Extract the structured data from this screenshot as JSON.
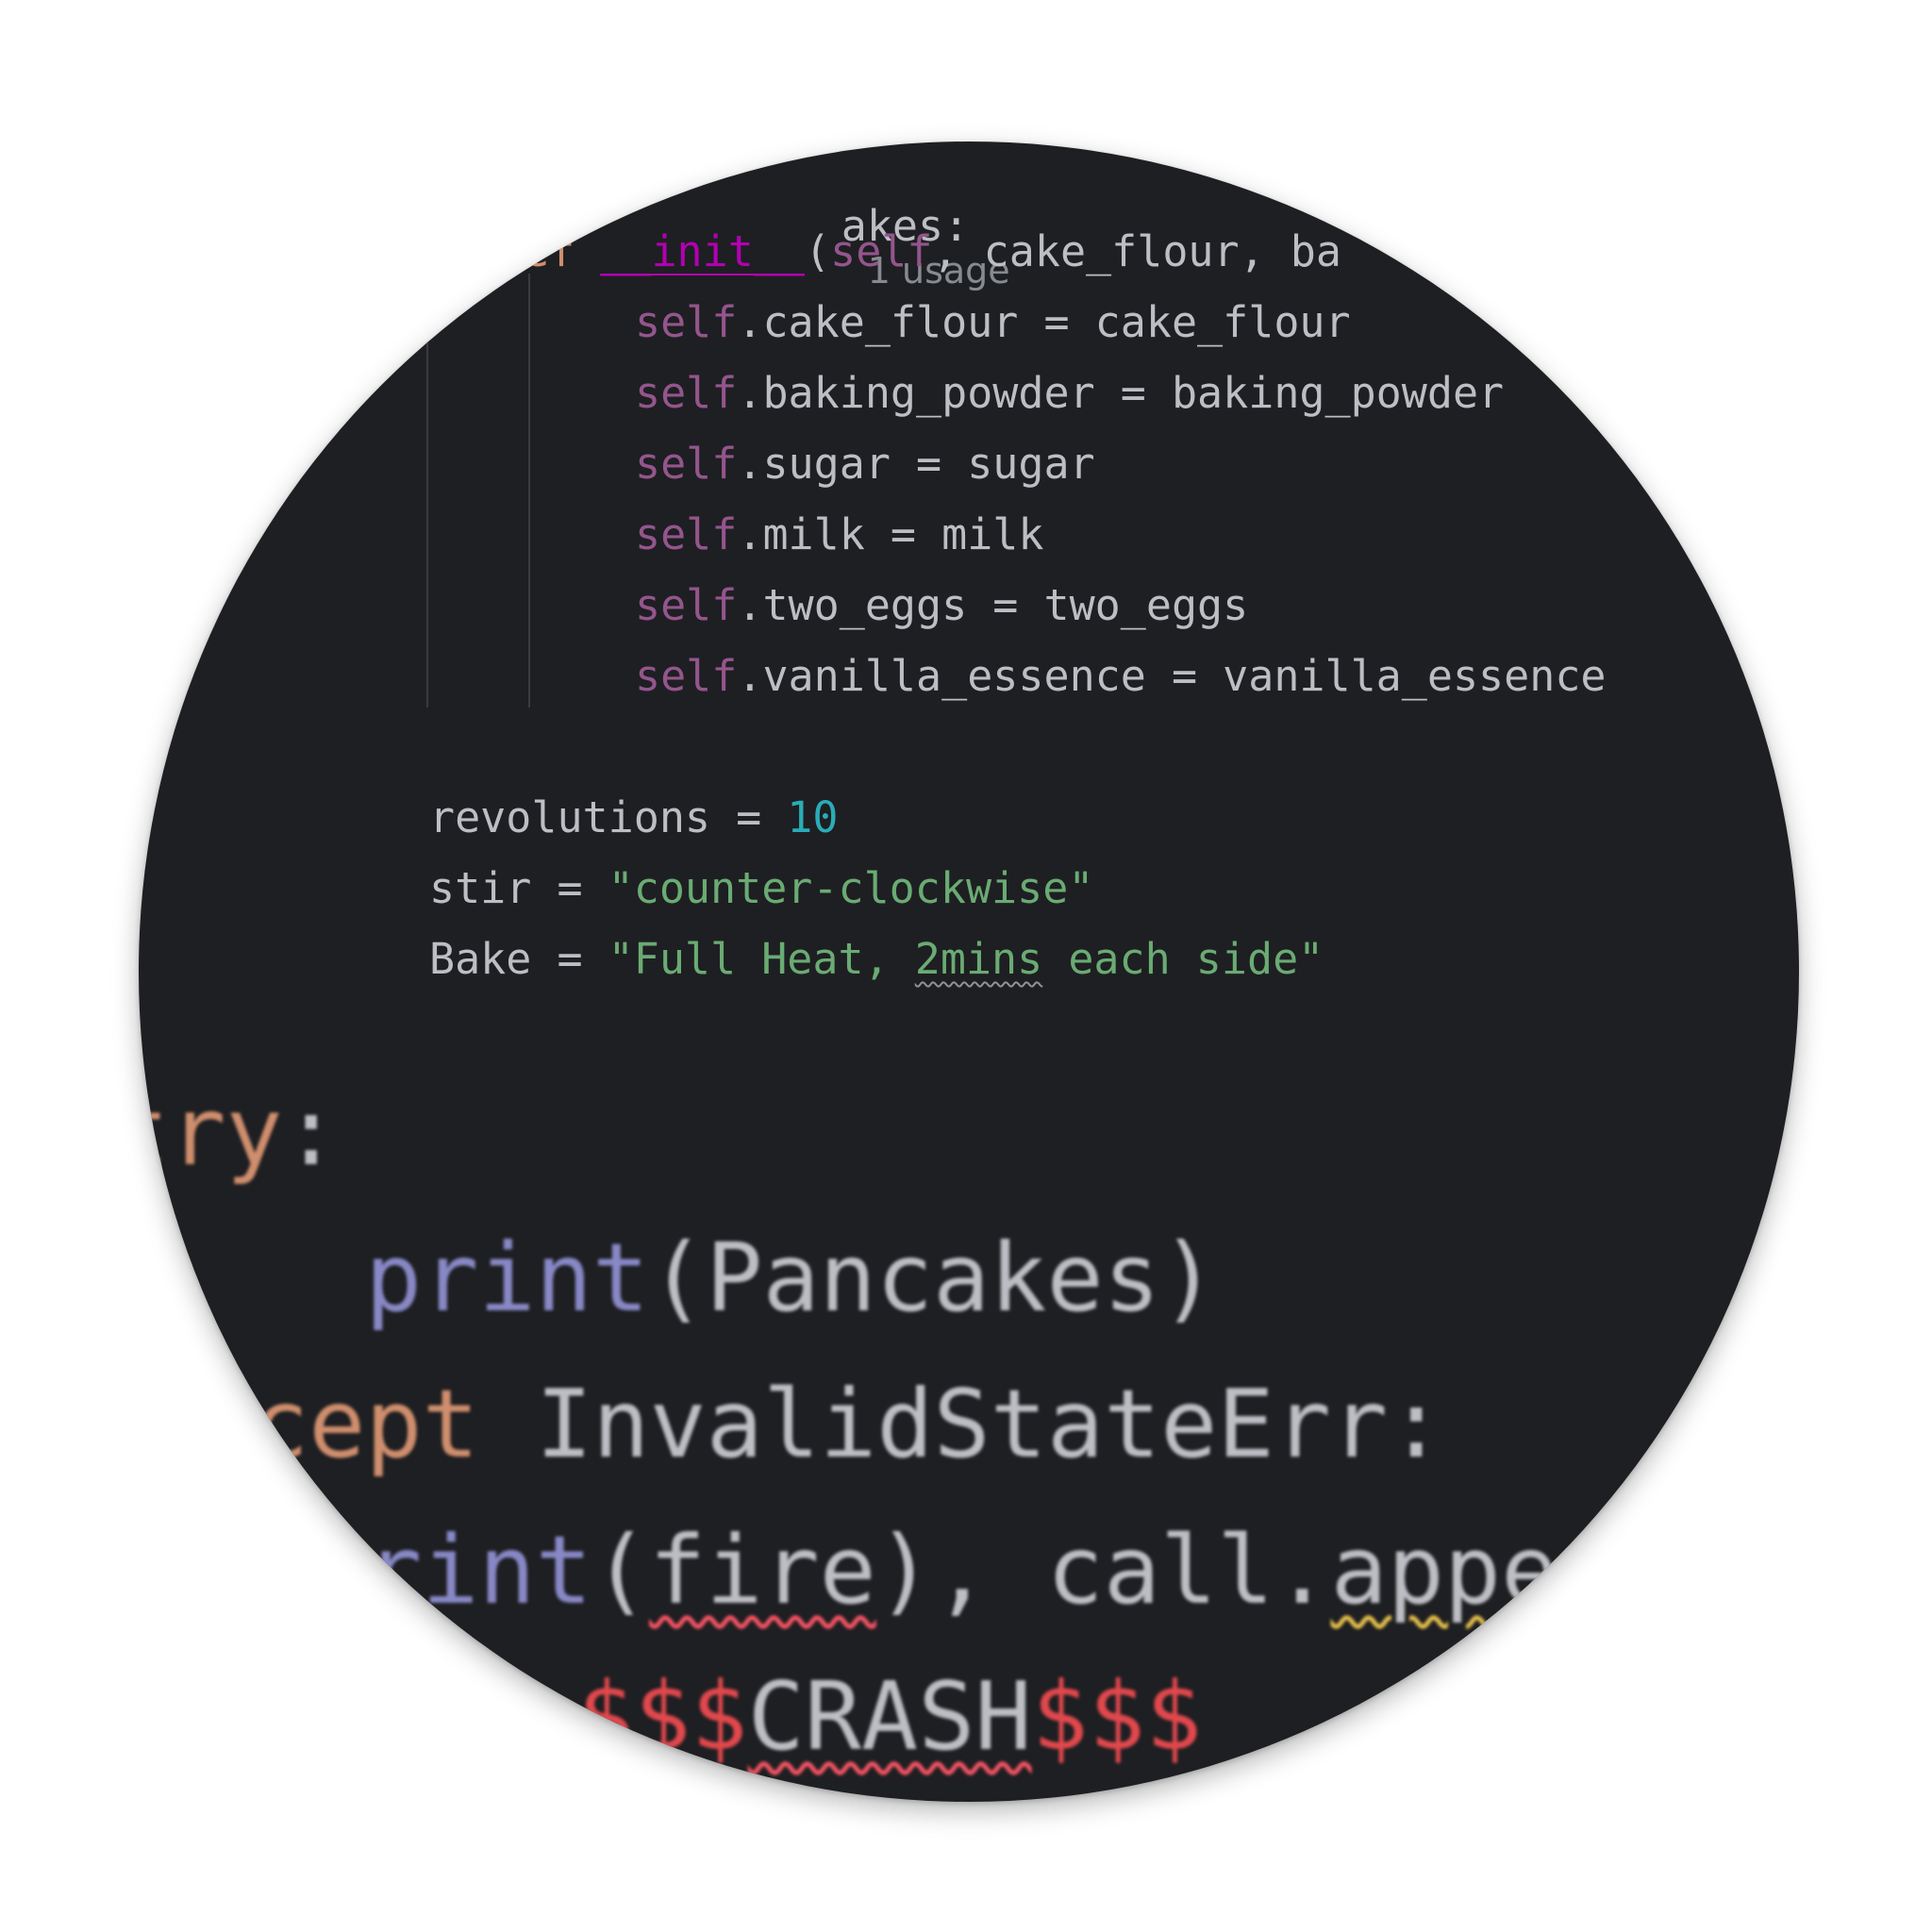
{
  "code": {
    "class_header": {
      "text": "akes:",
      "usage_hint": "1 usage"
    },
    "def_line": {
      "keyword": "ef",
      "name": "__init__",
      "open": "(",
      "self_kw": "self",
      "params": ", cake_flour, ba"
    },
    "assignments": [
      {
        "self_kw": "self",
        "rest": ".cake_flour = cake_flour"
      },
      {
        "self_kw": "self",
        "rest": ".baking_powder = baking_powder"
      },
      {
        "self_kw": "self",
        "rest": ".sugar = sugar"
      },
      {
        "self_kw": "self",
        "rest": ".milk = milk"
      },
      {
        "self_kw": "self",
        "rest": ".two_eggs = two_eggs"
      },
      {
        "self_kw": "self",
        "rest": ".vanilla_essence = vanilla_essence"
      }
    ],
    "revolutions": {
      "name": "revolutions = ",
      "value": "10"
    },
    "stir": {
      "name": "stir = ",
      "value": "\"counter-clockwise\""
    },
    "bake": {
      "name": "Bake = ",
      "value_a": "\"Full Heat, ",
      "value_typo": "2mins",
      "value_b": " each side\""
    },
    "try_line": {
      "keyword": "try",
      "colon": ":"
    },
    "print_line": {
      "fn": "print",
      "args": "(Pancakes)"
    },
    "except_line": {
      "keyword": "cept",
      "exception": " InvalidStateErr:"
    },
    "print_fire_line": {
      "fn": "rint",
      "open": "(",
      "arg": "fire",
      "close": "), call.",
      "tail": "appe"
    },
    "crash_line": {
      "dollars_left": "$$$",
      "word": "CRASH",
      "dollars_right": "$$$"
    }
  },
  "colors": {
    "background": "#1e1f22",
    "keyword": "#cf8e6d",
    "function": "#b200b2",
    "self": "#94558d",
    "number": "#2aacb8",
    "string": "#6aab73",
    "builtin": "#8888c6",
    "error": "#e0484d"
  }
}
